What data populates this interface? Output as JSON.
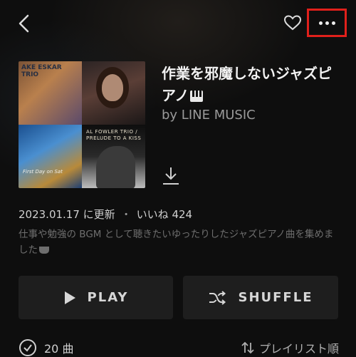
{
  "header": {
    "back_icon": "chevron-left-icon",
    "like_icon": "heart-icon",
    "more_icon": "more-horizontal-icon",
    "highlight_color": "#e0201b"
  },
  "album_art": {
    "tile1_text": "AKE ESKAR TRIO",
    "tile3_text": "First Day on Sat",
    "tile4_text": "AL FOWLER TRIO / PRELUDE TO A KISS"
  },
  "playlist": {
    "title": "作業を邪魔しないジャズピアノ",
    "title_icon": "piano-keyboard-emoji",
    "artist": "by LINE MUSIC",
    "download_icon": "download-icon",
    "updated": "2023.01.17 に更新",
    "separator": "・",
    "likes": "いいね 424",
    "description": "仕事や勉強の BGM として聴きたいゆったりしたジャズピアノ曲を集めました",
    "description_icon": "coffee-emoji"
  },
  "actions": {
    "play_label": "PLAY",
    "shuffle_label": "SHUFFLE"
  },
  "footer": {
    "track_count": "20 曲",
    "sort_label": "プレイリスト順"
  }
}
